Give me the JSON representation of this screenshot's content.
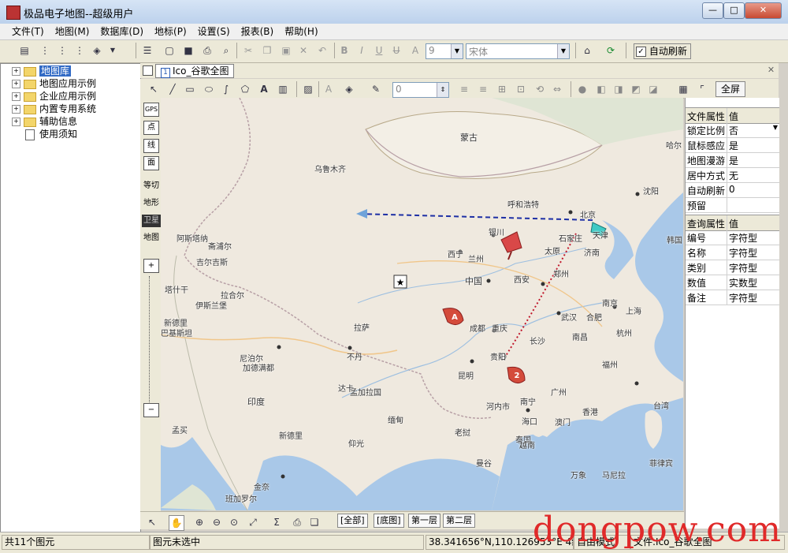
{
  "window": {
    "title": "极品电子地图--超级用户",
    "controls": [
      "—",
      "□",
      "✕"
    ]
  },
  "menu": [
    "文件(T)",
    "地图(M)",
    "数据库(D)",
    "地标(P)",
    "设置(S)",
    "报表(B)",
    "帮助(H)"
  ],
  "toolbar": {
    "font_size": "9",
    "font_name": "宋体",
    "auto_refresh_label": "自动刷新",
    "auto_refresh_checked": true
  },
  "tree": [
    {
      "label": "地图库",
      "expandable": true,
      "selected": true
    },
    {
      "label": "地图应用示例",
      "expandable": true
    },
    {
      "label": "企业应用示例",
      "expandable": true
    },
    {
      "label": "内置专用系统",
      "expandable": true
    },
    {
      "label": "辅助信息",
      "expandable": true
    },
    {
      "label": "使用须知",
      "expandable": false
    }
  ],
  "map_tab": {
    "label": "Ico_谷歌全图"
  },
  "drawbar": {
    "line_width": "0",
    "fullscreen_label": "全屏"
  },
  "vtools": {
    "gps": "GPS",
    "point": "点",
    "line": "线",
    "area": "面",
    "t1": "等切",
    "t2": "地形",
    "t3": "卫星",
    "t4": "地图",
    "zoom_in": "+",
    "zoom_out": "−"
  },
  "map": {
    "cities": [
      {
        "name": "蒙古",
        "big": true
      },
      {
        "name": "乌鲁木齐"
      },
      {
        "name": "呼和浩特"
      },
      {
        "name": "北京"
      },
      {
        "name": "天津"
      },
      {
        "name": "沈阳"
      },
      {
        "name": "银川"
      },
      {
        "name": "石家庄"
      },
      {
        "name": "太原"
      },
      {
        "name": "济南"
      },
      {
        "name": "西宁"
      },
      {
        "name": "兰州"
      },
      {
        "name": "中国",
        "big": true
      },
      {
        "name": "西安"
      },
      {
        "name": "郑州"
      },
      {
        "name": "南京"
      },
      {
        "name": "上海"
      },
      {
        "name": "武汉"
      },
      {
        "name": "合肥"
      },
      {
        "name": "杭州"
      },
      {
        "name": "成都"
      },
      {
        "name": "重庆"
      },
      {
        "name": "长沙"
      },
      {
        "name": "南昌"
      },
      {
        "name": "福州"
      },
      {
        "name": "贵阳"
      },
      {
        "name": "昆明"
      },
      {
        "name": "拉萨"
      },
      {
        "name": "南宁"
      },
      {
        "name": "广州"
      },
      {
        "name": "香港"
      },
      {
        "name": "澳门"
      },
      {
        "name": "台湾"
      },
      {
        "name": "海口"
      },
      {
        "name": "河内市"
      },
      {
        "name": "老挝"
      },
      {
        "name": "缅甸"
      },
      {
        "name": "不丹"
      },
      {
        "name": "尼泊尔"
      },
      {
        "name": "印度",
        "big": true
      },
      {
        "name": "巴基斯坦"
      },
      {
        "name": "新德里"
      },
      {
        "name": "加德满都"
      },
      {
        "name": "达卡"
      },
      {
        "name": "泰国"
      },
      {
        "name": "仰光"
      },
      {
        "name": "曼谷"
      },
      {
        "name": "越南"
      },
      {
        "name": "菲律宾"
      },
      {
        "name": "马尼拉"
      },
      {
        "name": "孟加拉国"
      },
      {
        "name": "孟买"
      },
      {
        "name": "金奈"
      },
      {
        "name": "塔什干"
      },
      {
        "name": "伊斯兰堡"
      },
      {
        "name": "拉合尔"
      },
      {
        "name": "斋浦尔"
      },
      {
        "name": "阿斯塔纳"
      },
      {
        "name": "吉尔吉斯"
      },
      {
        "name": "新德里"
      },
      {
        "name": "班加罗尔"
      },
      {
        "name": "万象"
      },
      {
        "name": "哈尔"
      },
      {
        "name": "韩国"
      }
    ],
    "markers": [
      {
        "label": "A"
      },
      {
        "label": "2"
      }
    ]
  },
  "layer_tabs": [
    "全部",
    "底图",
    "第一层",
    "第二层"
  ],
  "file_props": {
    "header": [
      "文件属性",
      "值"
    ],
    "rows": [
      [
        "锁定比例",
        "否"
      ],
      [
        "鼠标感应",
        "是"
      ],
      [
        "地图漫游",
        "是"
      ],
      [
        "居中方式",
        "无"
      ],
      [
        "自动刷新",
        "0"
      ],
      [
        "预留",
        ""
      ]
    ]
  },
  "query_props": {
    "header": [
      "查询属性",
      "值"
    ],
    "rows": [
      [
        "编号",
        "字符型"
      ],
      [
        "名称",
        "字符型"
      ],
      [
        "类别",
        "字符型"
      ],
      [
        "数值",
        "实数型"
      ],
      [
        "备注",
        "字符型"
      ]
    ]
  },
  "status": {
    "count": "共11个图元",
    "selection": "图元未选中",
    "coords": "38.341656°N,110.126953°E 4级",
    "mode": "自由模式",
    "file": "文件:Ico_谷歌全图"
  },
  "watermark": "dongpow.com"
}
